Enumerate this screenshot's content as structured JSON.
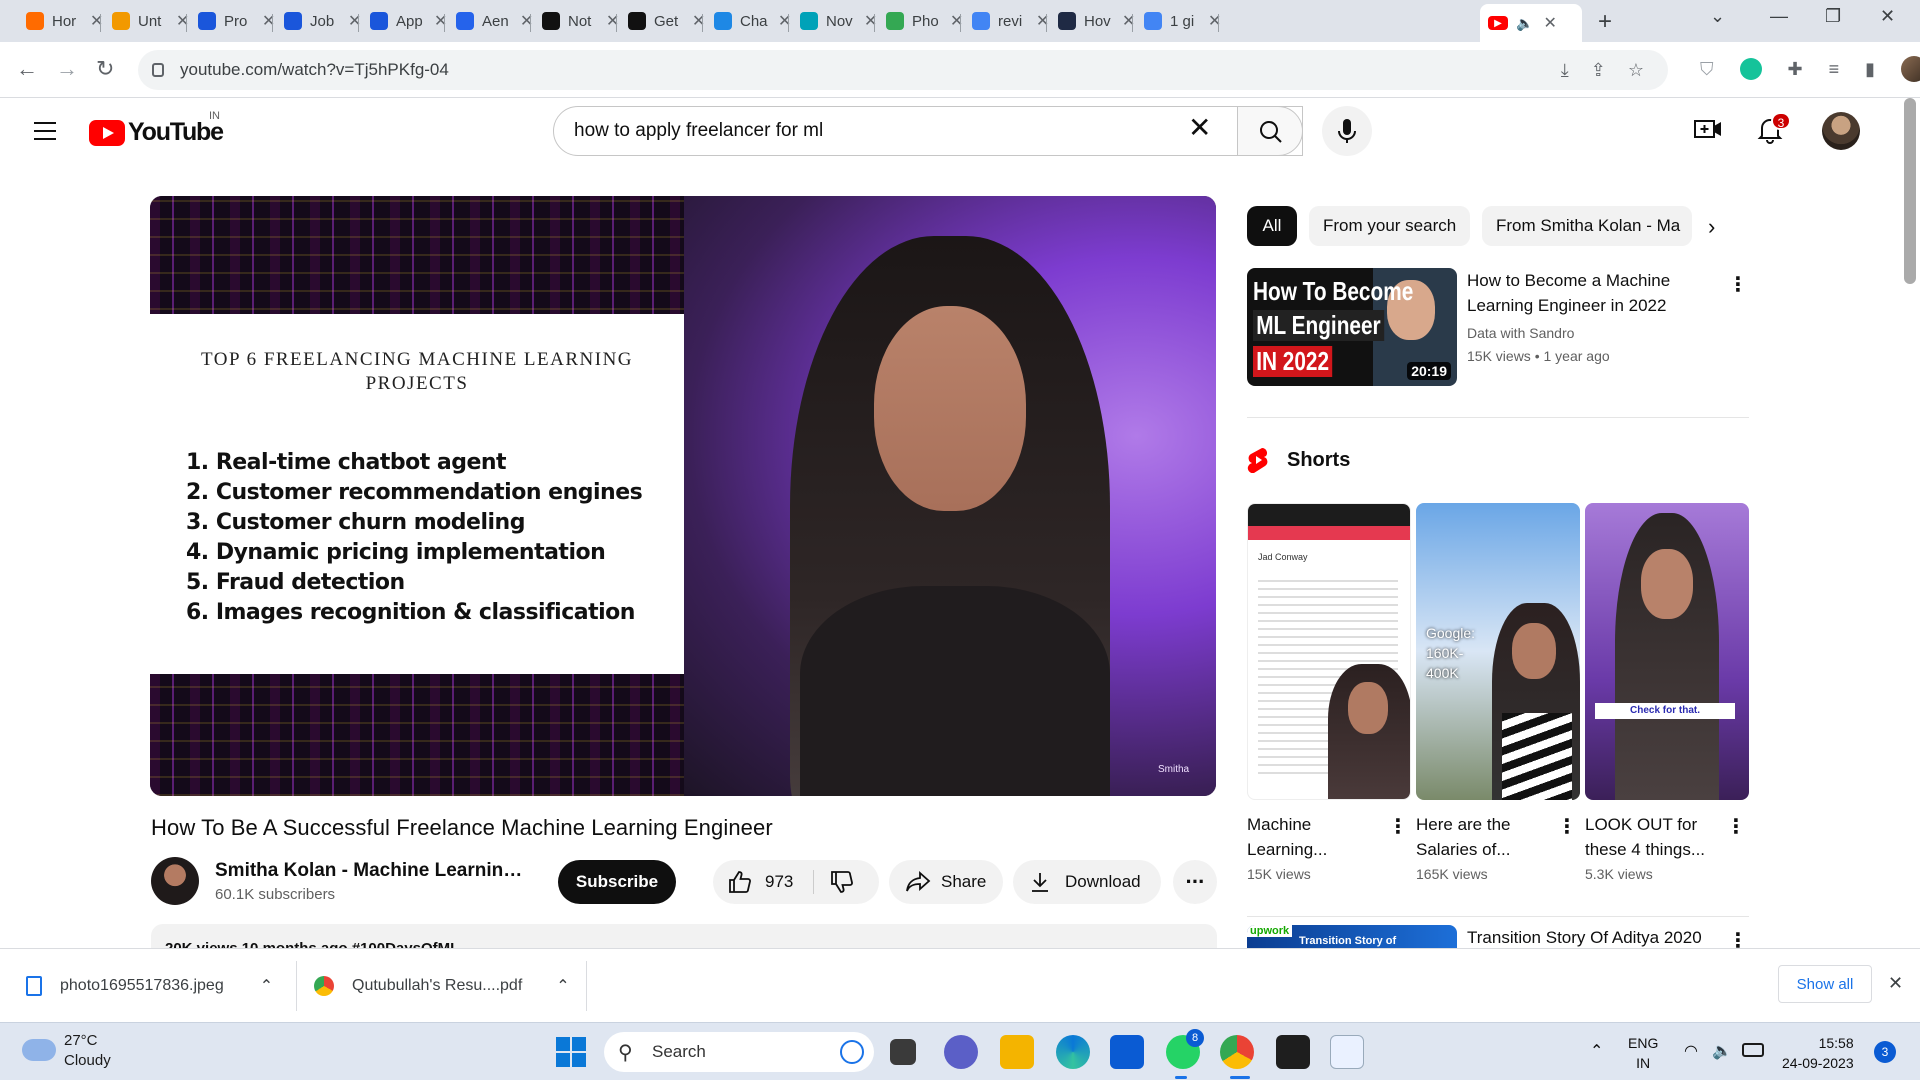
{
  "browser": {
    "tabs": [
      {
        "label": "Hor",
        "icon": "loader-icon",
        "color": "#ff6b00"
      },
      {
        "label": "Unt",
        "icon": "doc-icon",
        "color": "#f29900"
      },
      {
        "label": "Pro",
        "icon": "kite-icon",
        "color": "#1a56db"
      },
      {
        "label": "Job",
        "icon": "kite-icon",
        "color": "#1a56db"
      },
      {
        "label": "App",
        "icon": "kite-icon",
        "color": "#1a56db"
      },
      {
        "label": "Aen",
        "icon": "aeri-icon",
        "color": "#2563eb"
      },
      {
        "label": "Not",
        "icon": "ri-icon",
        "color": "#111111"
      },
      {
        "label": "Get",
        "icon": "ri-icon",
        "color": "#111111"
      },
      {
        "label": "Cha",
        "icon": "arrow-icon",
        "color": "#1e88e5"
      },
      {
        "label": "Nov",
        "icon": "n-icon",
        "color": "#00a2b8"
      },
      {
        "label": "Pho",
        "icon": "pinwheel-icon",
        "color": "#34a853"
      },
      {
        "label": "revi",
        "icon": "google-icon",
        "color": "#4285f4"
      },
      {
        "label": "Hov",
        "icon": "tds-icon",
        "color": "#1f2a44"
      },
      {
        "label": "1 gi",
        "icon": "google-icon",
        "color": "#4285f4"
      }
    ],
    "active_tab": {
      "icon": "youtube-icon",
      "color": "#ff0000"
    },
    "url": "youtube.com/watch?v=Tj5hPKfg-04"
  },
  "youtube": {
    "logo_text": "YouTube",
    "country_code": "IN",
    "search_query": "how to apply freelancer for ml",
    "notifications_count": "3"
  },
  "video": {
    "slide_title": "TOP 6 FREELANCING MACHINE LEARNING PROJECTS",
    "slide_items": [
      "1. Real-time chatbot agent",
      "2. Customer recommendation engines",
      "3. Customer churn modeling",
      "4. Dynamic pricing implementation",
      "5. Fraud detection",
      "6. Images recognition & classification"
    ],
    "watermark": "Smitha",
    "title": "How To Be A Successful Freelance Machine Learning Engineer",
    "channel": "Smitha Kolan - Machine Learning Engineer",
    "subscribers": "60.1K subscribers",
    "subscribe_label": "Subscribe",
    "likes": "973",
    "share_label": "Share",
    "download_label": "Download",
    "description_preview": "20K views  10 months ago  #100DaysOfML"
  },
  "sidebar": {
    "chips": [
      "All",
      "From your search",
      "From Smitha Kolan - Ma"
    ],
    "recommended": {
      "thumb_line1": "How To Become",
      "thumb_line2": "ML Engineer",
      "thumb_line3": "IN 2022",
      "duration": "20:19",
      "title": "How to Become a Machine Learning Engineer in 2022",
      "channel": "Data with Sandro",
      "views": "15K views",
      "age": "1 year ago"
    },
    "shorts_label": "Shorts",
    "shorts": [
      {
        "title": "Machine Learning...",
        "views": "15K views",
        "overlay": "Jad Conway"
      },
      {
        "title": "Here are the Salaries of...",
        "views": "165K views",
        "overlay": "Google: 160K-400K"
      },
      {
        "title": "LOOK OUT for these 4 things...",
        "views": "5.3K views",
        "overlay": "Check for that."
      }
    ],
    "next_video": {
      "thumb_text": "Transition Story of",
      "brand": "upwork",
      "title": "Transition Story Of Aditya 2020"
    }
  },
  "downloads": {
    "items": [
      "photo1695517836.jpeg",
      "Qutubullah's Resu....pdf"
    ],
    "show_all": "Show all"
  },
  "taskbar": {
    "temperature": "27°C",
    "weather": "Cloudy",
    "search_placeholder": "Search",
    "whatsapp_badge": "8",
    "language": "ENG",
    "region": "IN",
    "time": "15:58",
    "date": "24-09-2023",
    "notifications": "3"
  }
}
